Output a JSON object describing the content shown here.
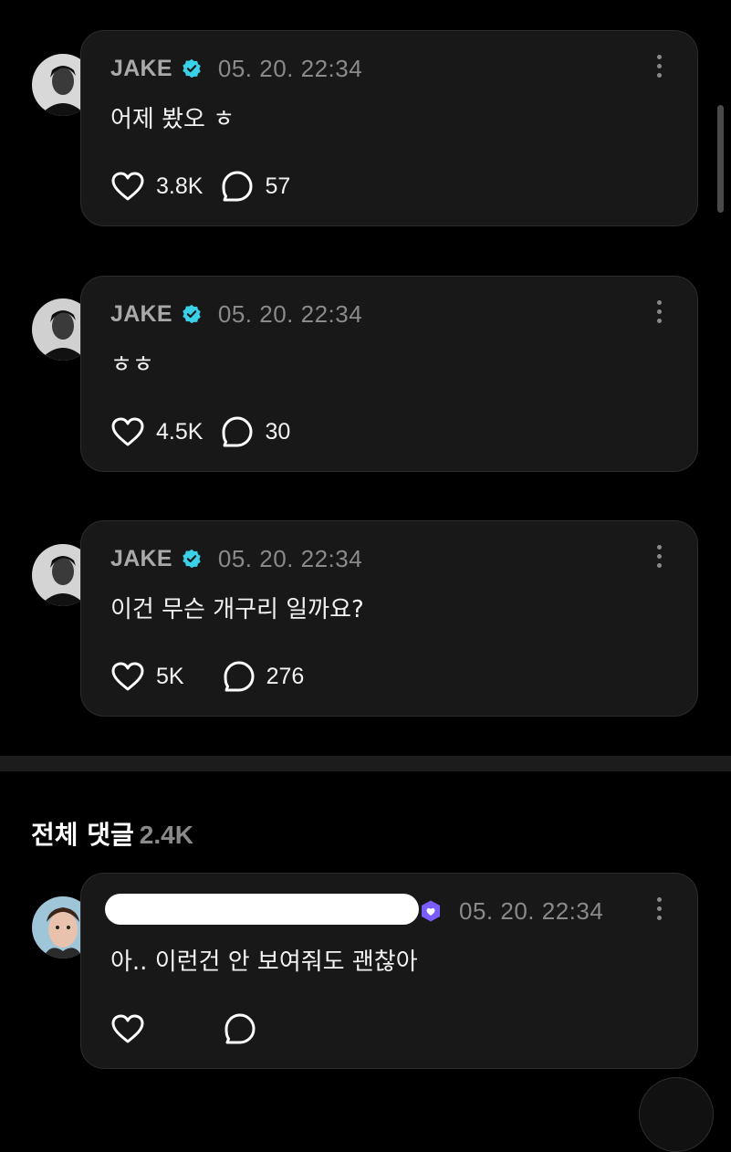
{
  "posts": [
    {
      "author": "JAKE",
      "date": "05. 20. 22:34",
      "text": "어제 봤오 ㅎ",
      "likes": "3.8K",
      "comments": "57"
    },
    {
      "author": "JAKE",
      "date": "05. 20. 22:34",
      "text": "ㅎㅎ",
      "likes": "4.5K",
      "comments": "30"
    },
    {
      "author": "JAKE",
      "date": "05. 20. 22:34",
      "text": "이건 무슨 개구리 일까요?",
      "likes": "5K",
      "comments": "276"
    }
  ],
  "comments_section": {
    "title": "전체 댓글",
    "count": "2.4K"
  },
  "comment": {
    "date": "05. 20. 22:34",
    "text": "아.. 이런건 안 보여줘도 괜찮아"
  },
  "colors": {
    "background": "#000000",
    "card": "#181818",
    "verified_badge": "#3ad0e8",
    "fan_badge": "#7b5cff"
  },
  "icons": {
    "like": "heart-outline-icon",
    "comment": "speech-bubble-outline-icon",
    "more": "vertical-ellipsis-icon",
    "verified": "verified-check-badge-icon"
  }
}
